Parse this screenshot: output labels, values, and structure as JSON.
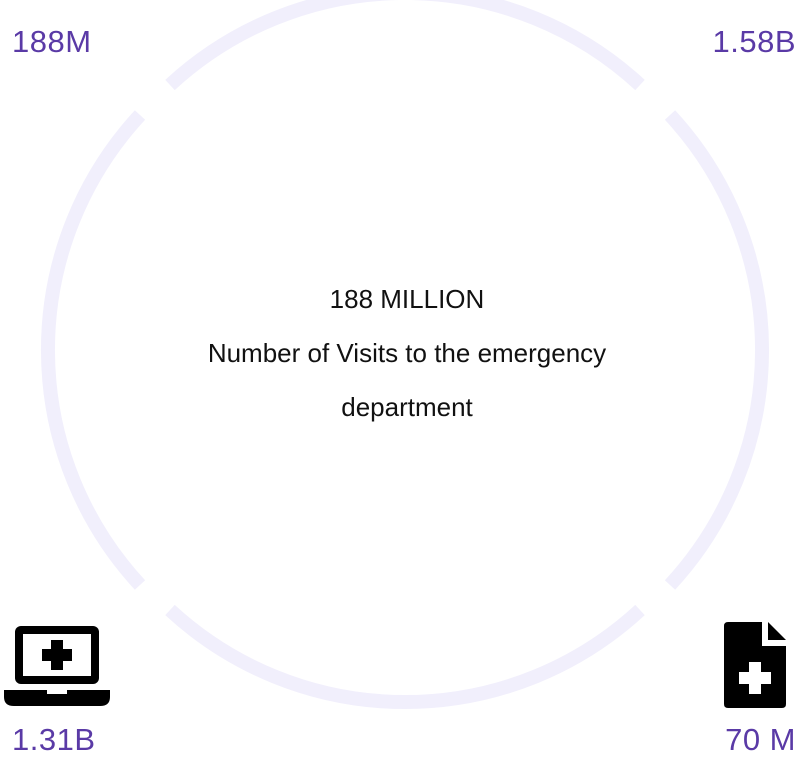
{
  "stats": {
    "top_left": "188M",
    "top_right": "1.58B",
    "bottom_left": "1.31B",
    "bottom_right": "70 M"
  },
  "center": {
    "headline": "188 MILLION",
    "desc_line1": "Number of Visits to the emergency",
    "desc_line2": "department"
  },
  "icons": {
    "bottom_left": "laptop-medical-icon",
    "bottom_right": "file-medical-icon"
  },
  "colors": {
    "stat_text": "#5a3aa6",
    "ring": "#f1effc",
    "body_text": "#111111"
  }
}
